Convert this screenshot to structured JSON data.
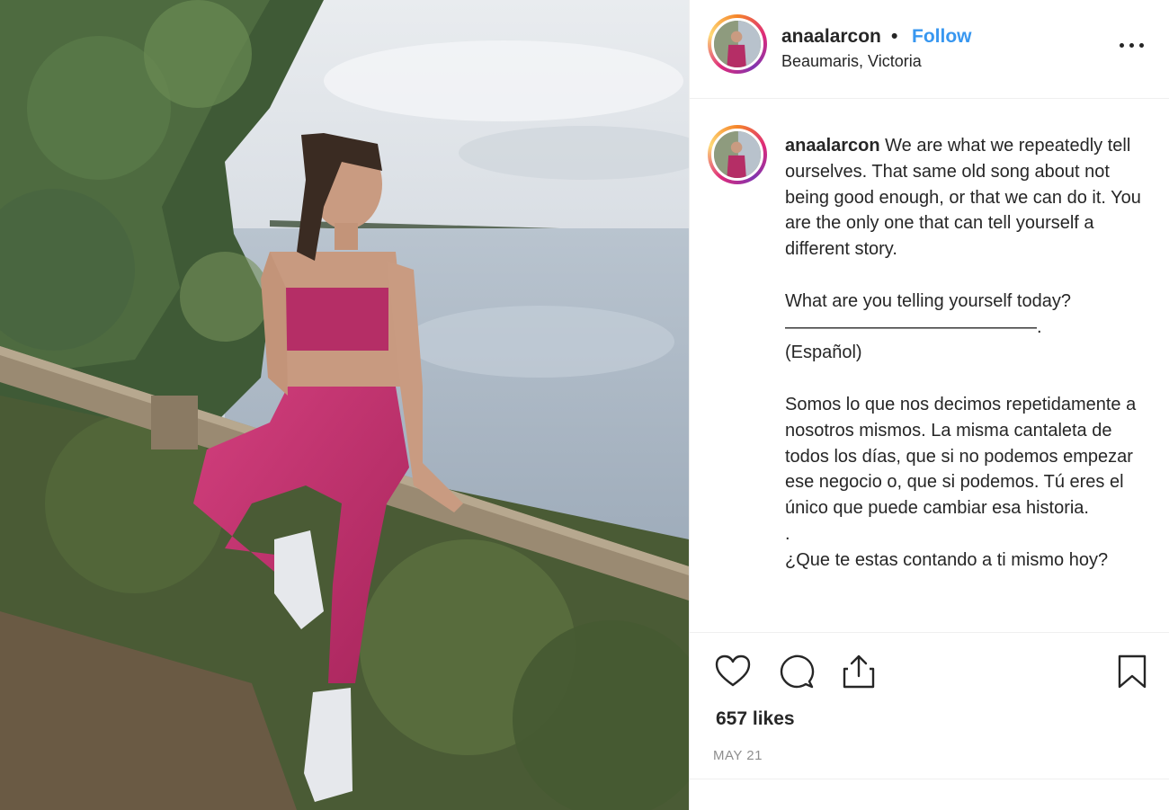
{
  "post": {
    "username": "anaalarcon",
    "separator": "•",
    "follow_label": "Follow",
    "location": "Beaumaris, Victoria",
    "caption": {
      "username": "anaalarcon",
      "text": " We are what we repeatedly tell ourselves. That same old song about not being good enough, or that we can do it. You are the only one that can tell yourself a different story.\n\nWhat are you telling yourself today?\n——————————————.\n(Español)\n\nSomos lo que nos decimos repetidamente a nosotros mismos. La misma cantaleta de todos los días, que si no podemos empezar ese negocio o, que si podemos. Tú eres el único que puede cambiar esa historia.\n.\n¿Que te estas contando a ti mismo hoy?"
    },
    "likes": "657 likes",
    "date": "MAY 21"
  },
  "icons": {
    "more": "more-options-icon",
    "like": "heart-icon",
    "comment": "comment-icon",
    "share": "share-icon",
    "save": "bookmark-icon"
  },
  "colors": {
    "link": "#3897f0",
    "text": "#262626",
    "muted": "#8e8e8e",
    "divider": "#efefef"
  }
}
